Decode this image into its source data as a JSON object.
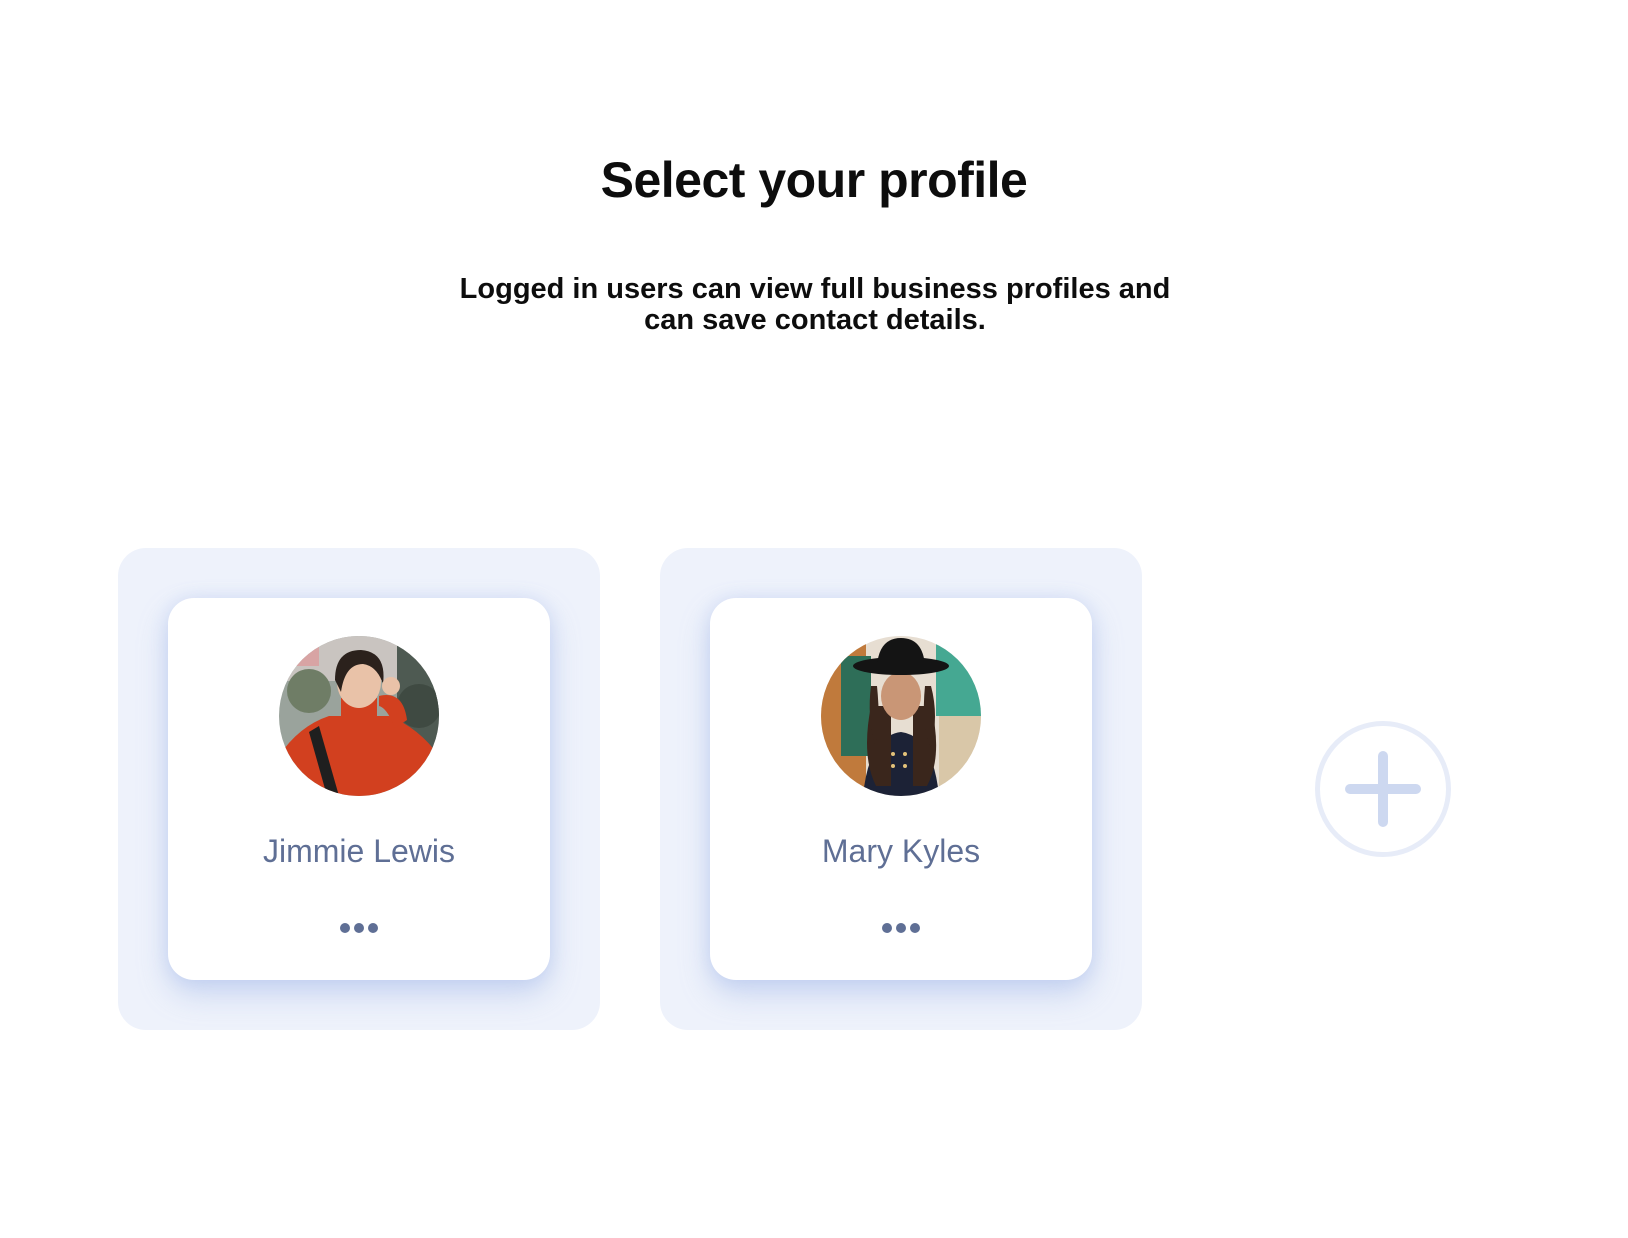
{
  "header": {
    "title": "Select your profile",
    "subtitle": "Logged in users can view full business profiles and can save contact details."
  },
  "profiles": [
    {
      "name": "Jimmie Lewis",
      "avatar_icon": "avatar-photo",
      "more_icon": "more-dots-icon"
    },
    {
      "name": "Mary Kyles",
      "avatar_icon": "avatar-photo",
      "more_icon": "more-dots-icon"
    }
  ],
  "add_profile": {
    "icon": "plus-icon"
  },
  "colors": {
    "tile_background": "#eef2fb",
    "name_text": "#5f6f95",
    "add_button_ring": "#e7ecf8",
    "plus_icon": "#cdd8f0"
  }
}
